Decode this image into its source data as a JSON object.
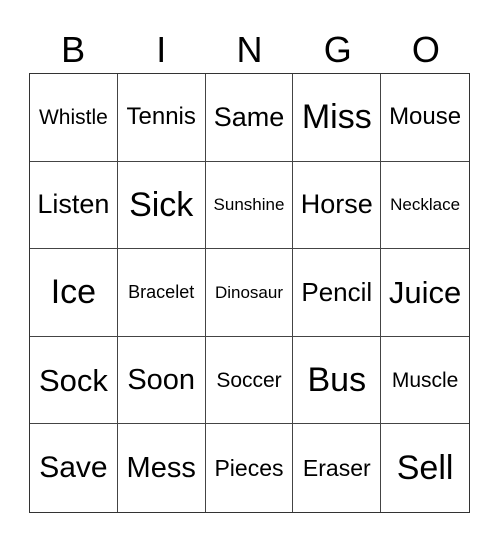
{
  "header": {
    "letters": [
      "B",
      "I",
      "N",
      "G",
      "O"
    ]
  },
  "card": {
    "rows": [
      [
        "Whistle",
        "Tennis",
        "Same",
        "Miss",
        "Mouse"
      ],
      [
        "Listen",
        "Sick",
        "Sunshine",
        "Horse",
        "Necklace"
      ],
      [
        "Ice",
        "Bracelet",
        "Dinosaur",
        "Pencil",
        "Juice"
      ],
      [
        "Sock",
        "Soon",
        "Soccer",
        "Bus",
        "Muscle"
      ],
      [
        "Save",
        "Mess",
        "Pieces",
        "Eraser",
        "Sell"
      ]
    ]
  }
}
